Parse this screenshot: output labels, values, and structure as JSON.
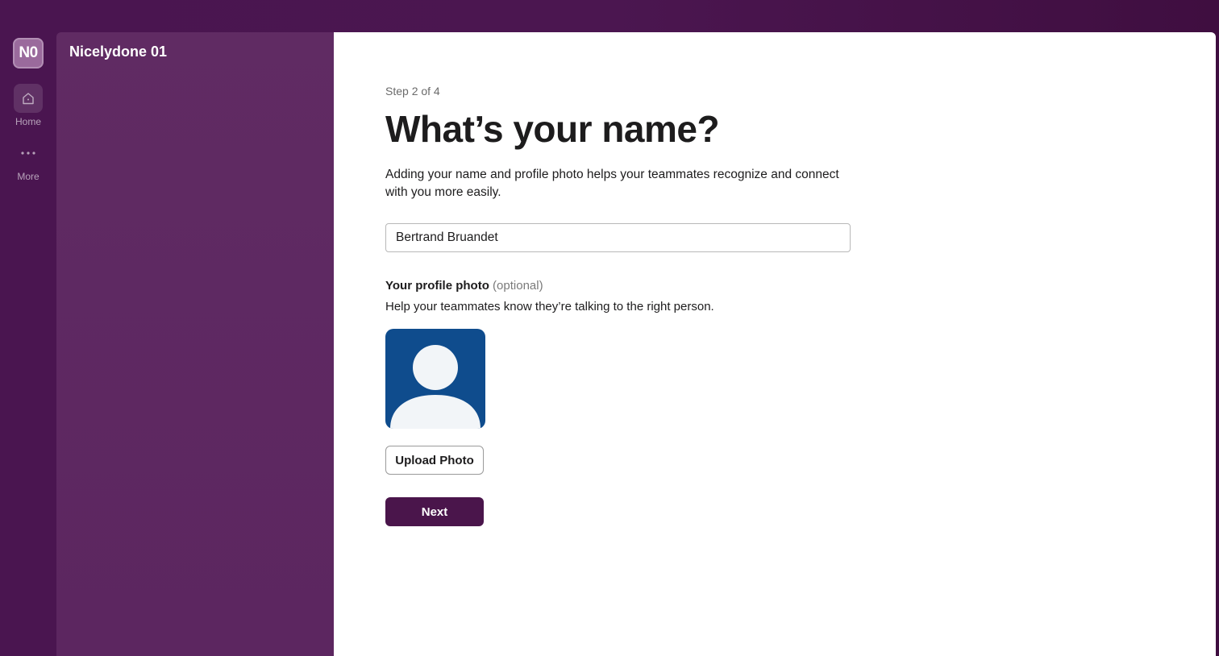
{
  "workspace": {
    "initials": "N0",
    "name": "Nicelydone 01"
  },
  "rail": {
    "items": [
      {
        "label": "Home",
        "icon": "home-icon"
      },
      {
        "label": "More",
        "icon": "more-dots-icon"
      }
    ]
  },
  "onboarding": {
    "step": "Step 2 of 4",
    "title": "What’s your name?",
    "description": "Adding your name and profile photo helps your teammates recognize and connect with you more easily.",
    "name_value": "Bertrand Bruandet",
    "photo_heading": "Your profile photo",
    "photo_optional": "(optional)",
    "photo_help": "Help your teammates know they’re talking to the right person.",
    "upload_label": "Upload Photo",
    "next_label": "Next"
  },
  "colors": {
    "aubergine": "#4a154b",
    "avatar_bg": "#0f4c8d"
  }
}
